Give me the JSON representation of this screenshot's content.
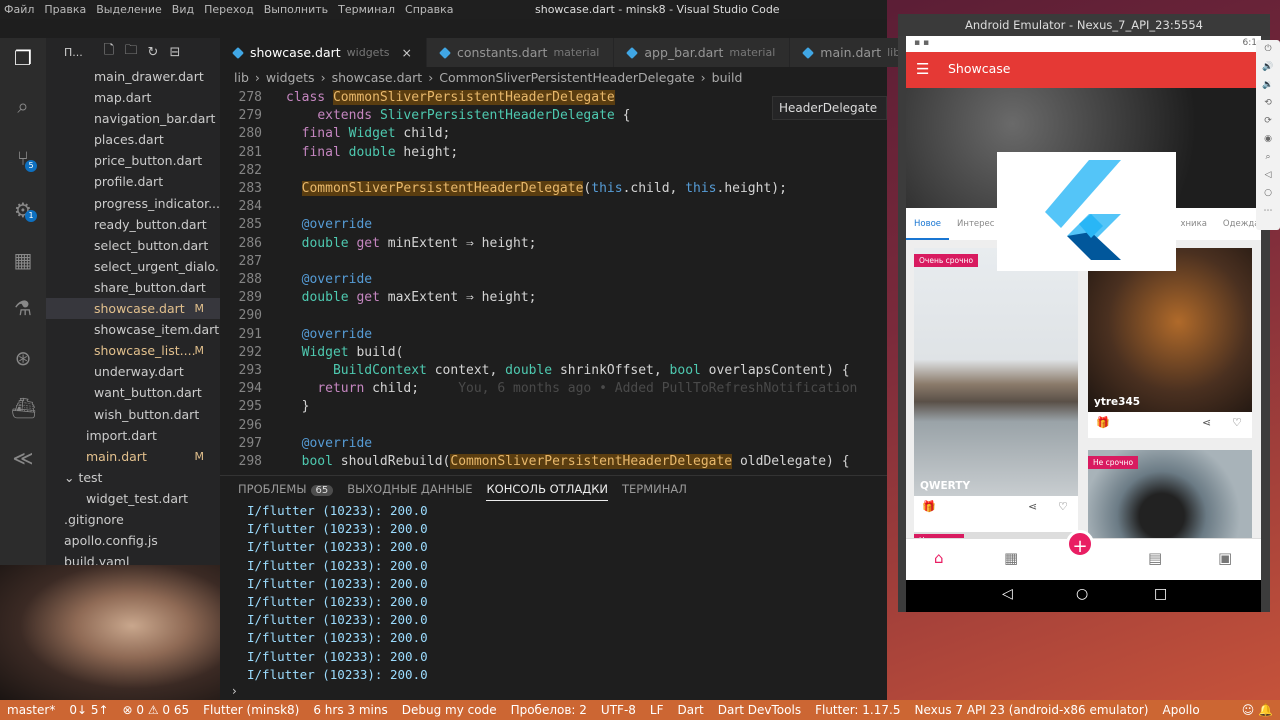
{
  "window": {
    "title": "showcase.dart - minsk8 - Visual Studio Code",
    "menu": [
      "Файл",
      "Правка",
      "Выделение",
      "Вид",
      "Переход",
      "Выполнить",
      "Терминал",
      "Справка"
    ]
  },
  "activity": {
    "scm_badge": "5",
    "debug_badge": "1"
  },
  "explorer": {
    "header": "П...",
    "files": [
      {
        "name": "main_drawer.dart",
        "indent": 2
      },
      {
        "name": "map.dart",
        "indent": 2
      },
      {
        "name": "navigation_bar.dart",
        "indent": 2
      },
      {
        "name": "places.dart",
        "indent": 2
      },
      {
        "name": "price_button.dart",
        "indent": 2
      },
      {
        "name": "profile.dart",
        "indent": 2
      },
      {
        "name": "progress_indicator....",
        "indent": 2
      },
      {
        "name": "ready_button.dart",
        "indent": 2
      },
      {
        "name": "select_button.dart",
        "indent": 2
      },
      {
        "name": "select_urgent_dialo...",
        "indent": 2
      },
      {
        "name": "share_button.dart",
        "indent": 2
      },
      {
        "name": "showcase.dart",
        "indent": 2,
        "mark": "M",
        "selected": true
      },
      {
        "name": "showcase_item.dart",
        "indent": 2
      },
      {
        "name": "showcase_list....",
        "indent": 2,
        "mark": "M"
      },
      {
        "name": "underway.dart",
        "indent": 2
      },
      {
        "name": "want_button.dart",
        "indent": 2
      },
      {
        "name": "wish_button.dart",
        "indent": 2
      },
      {
        "name": "import.dart",
        "indent": 1
      },
      {
        "name": "main.dart",
        "indent": 1,
        "mark": "M"
      },
      {
        "name": "test",
        "indent": 0,
        "folder": true
      },
      {
        "name": "widget_test.dart",
        "indent": 1
      },
      {
        "name": ".gitignore",
        "indent": 0
      },
      {
        "name": "apollo.config.js",
        "indent": 0
      },
      {
        "name": "build.yaml",
        "indent": 0
      }
    ]
  },
  "tabs": [
    {
      "label": "showcase.dart",
      "desc": "widgets",
      "active": true,
      "close": "×"
    },
    {
      "label": "constants.dart",
      "desc": "material"
    },
    {
      "label": "app_bar.dart",
      "desc": "material"
    },
    {
      "label": "main.dart",
      "desc": "lib"
    }
  ],
  "breadcrumbs": [
    "lib",
    "widgets",
    "showcase.dart",
    "CommonSliverPersistentHeaderDelegate",
    "build"
  ],
  "peek": "HeaderDelegate",
  "editor": {
    "line_numbers": [
      "278",
      "279",
      "280",
      "281",
      "282",
      "283",
      "284",
      "285",
      "286",
      "287",
      "288",
      "289",
      "290",
      "291",
      "292",
      "293",
      "294",
      "295",
      "296",
      "297",
      "298"
    ],
    "blame": "You, 6 months ago • Added PullToRefreshNotification"
  },
  "panel": {
    "tabs": [
      "ПРОБЛЕМЫ",
      "ВЫХОДНЫЕ ДАННЫЕ",
      "КОНСОЛЬ ОТЛАДКИ",
      "ТЕРМИНАЛ"
    ],
    "problems_count": "65",
    "console_lines": [
      "I/flutter (10233): 200.0",
      "I/flutter (10233): 200.0",
      "I/flutter (10233): 200.0",
      "I/flutter (10233): 200.0",
      "I/flutter (10233): 200.0",
      "I/flutter (10233): 200.0",
      "I/flutter (10233): 200.0",
      "I/flutter (10233): 200.0",
      "I/flutter (10233): 200.0",
      "I/flutter (10233): 200.0"
    ],
    "prompt": "›"
  },
  "status": [
    "master*",
    "0↓ 5↑",
    "⊗ 0 ⚠ 0 65",
    "Flutter (minsk8)",
    "6 hrs 3 mins",
    "Debug my code",
    "Пробелов: 2",
    "UTF-8",
    "LF",
    "Dart",
    "Dart DevTools",
    "Flutter: 1.17.5",
    "Nexus 7 API 23 (android-x86 emulator)",
    "Apollo"
  ],
  "emulator": {
    "title": "Android Emulator - Nexus_7_API_23:5554",
    "time": "6:1",
    "app_title": "Showcase",
    "categories": [
      "Новое",
      "Интерес",
      "хника",
      "Одежда"
    ],
    "cards": [
      {
        "badge": "Очень срочно",
        "title": "QWERTY"
      },
      {
        "badge": "",
        "title": "ytre345"
      },
      {
        "badge": "Не срочно",
        "title": ""
      },
      {
        "badge": "Не срочно",
        "title": ""
      }
    ],
    "fab": "+"
  },
  "colors": {
    "status_bg": "#cc6633",
    "appbar": "#e53935",
    "accent": "#1976d2",
    "badge": "#d81b60"
  }
}
